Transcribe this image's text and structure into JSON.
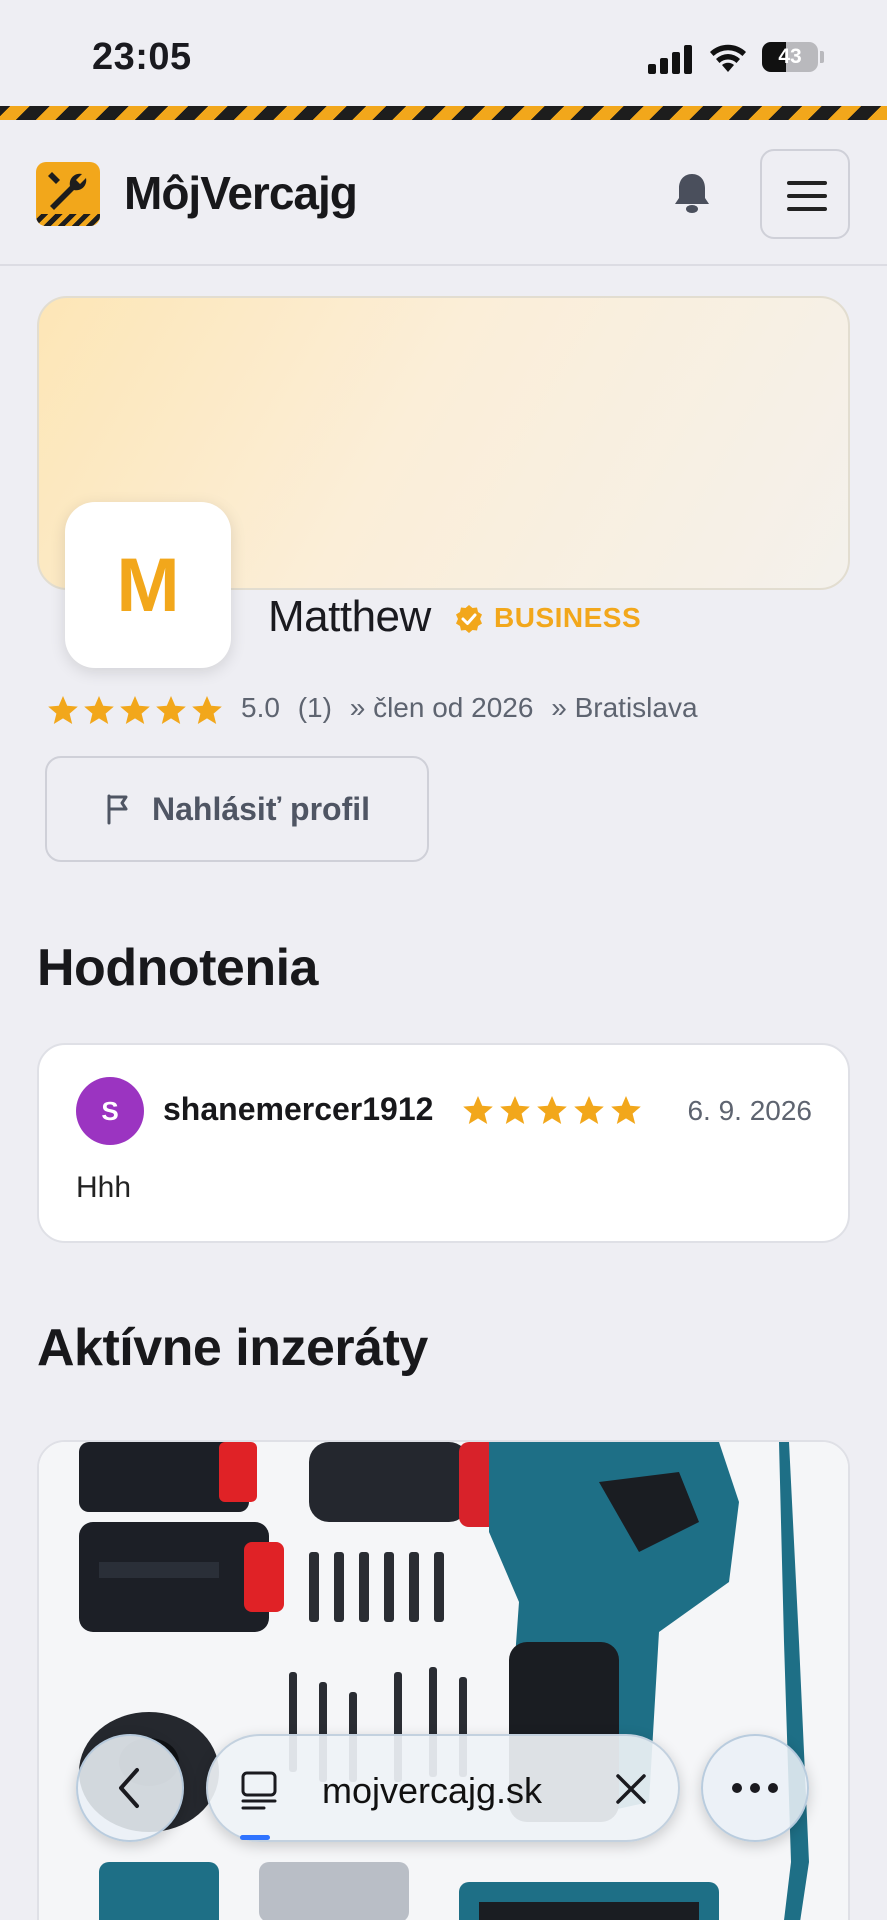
{
  "status_bar": {
    "time": "23:05",
    "battery": "43",
    "battery_level": 0.43
  },
  "header": {
    "brand": "MôjVercajg"
  },
  "profile": {
    "initial": "M",
    "name": "Matthew",
    "badge": "BUSINESS",
    "rating": 5,
    "rating_value": "5.0",
    "rating_count": "(1)",
    "member_since": "» člen od 2026",
    "location": "» Bratislava",
    "report_button": "Nahlásiť profil"
  },
  "reviews": {
    "heading": "Hodnotenia",
    "items": [
      {
        "initial": "S",
        "user": "shanemercer1912",
        "stars": 5,
        "date": "6. 9. 2026",
        "text": "Hhh",
        "avatar_color": "#9b34c1"
      }
    ]
  },
  "listings": {
    "heading": "Aktívne inzeráty"
  },
  "browser": {
    "url": "mojvercajg.sk"
  },
  "colors": {
    "accent": "#f2a71b",
    "background": "#eeeef3",
    "dark": "#1d1d1d"
  }
}
